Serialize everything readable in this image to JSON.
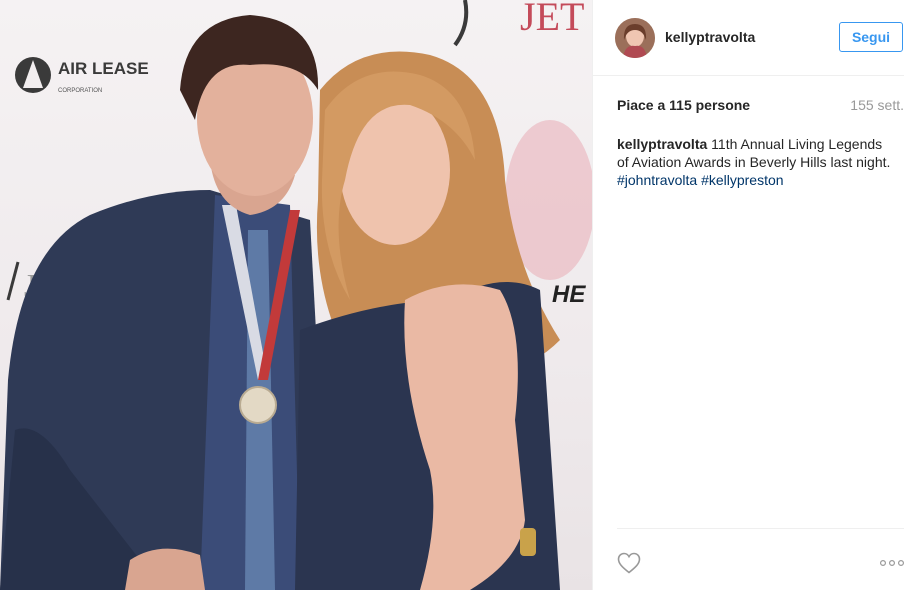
{
  "post": {
    "image_alt": "Photo of two people at a red carpet event",
    "backdrop_logos": [
      "AIR LEASE",
      "CORPORATION",
      "JET",
      "HE"
    ]
  },
  "header": {
    "username": "kellyptravolta",
    "follow_label": "Segui",
    "follow_color": "#3897f0"
  },
  "stats": {
    "likes_text": "Piace a 115 persone",
    "time_text": "155 sett."
  },
  "caption": {
    "username": "kellyptravolta",
    "text": "11th Annual Living Legends of Aviation Awards in Beverly Hills last night.",
    "hashtags": [
      "#johntravolta",
      "#kellypreston"
    ]
  },
  "actions": {
    "like_icon": "heart-icon",
    "more_icon": "more-options-icon"
  }
}
